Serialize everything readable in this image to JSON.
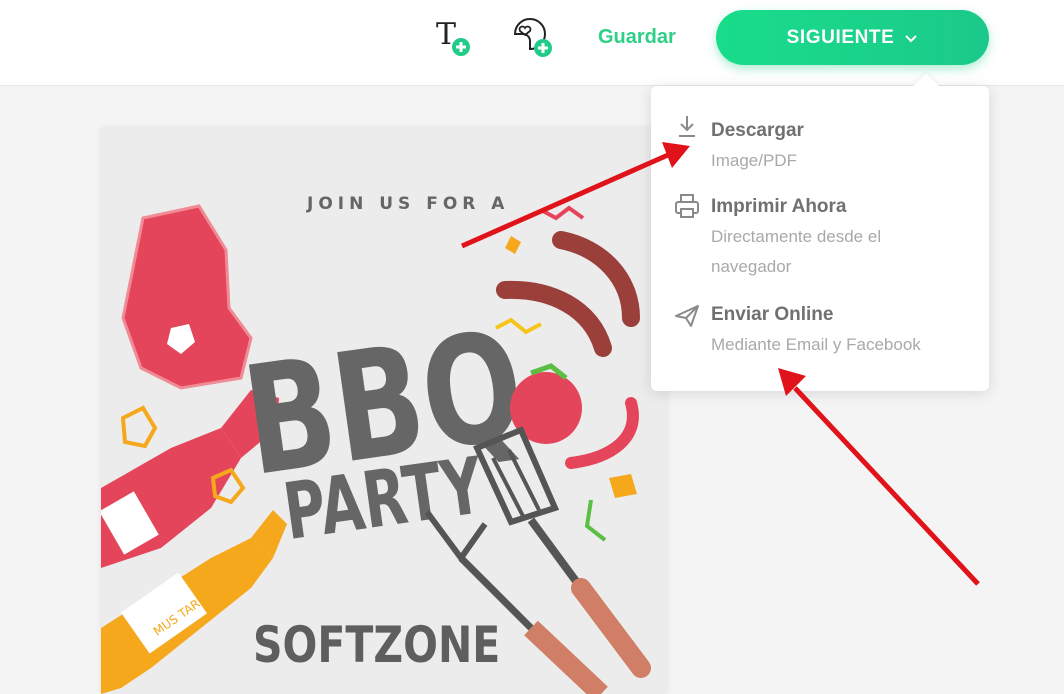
{
  "toolbar": {
    "add_text_icon": "text-plus-icon",
    "add_sticker_icon": "sticker-plus-icon",
    "save_label": "Guardar",
    "next_label": "SIGUIENTE"
  },
  "menu": {
    "items": [
      {
        "icon": "download-icon",
        "title": "Descargar",
        "subtitle": "Image/PDF"
      },
      {
        "icon": "printer-icon",
        "title": "Imprimir Ahora",
        "subtitle": "Directamente desde el navegador"
      },
      {
        "icon": "paper-plane-icon",
        "title": "Enviar Online",
        "subtitle": "Mediante Email y Facebook"
      }
    ]
  },
  "design": {
    "tagline": "JOIN US FOR A",
    "headline": "BBQ",
    "subheadline": "PARTY",
    "mustard_label": "MUS TARD",
    "brand": "SOFTZONE"
  },
  "colors": {
    "accent": "#1fd38a",
    "annotation_arrow": "#e0131b",
    "meat_red": "#e5455a",
    "mustard": "#f5a81c",
    "text_grey": "#666666"
  }
}
